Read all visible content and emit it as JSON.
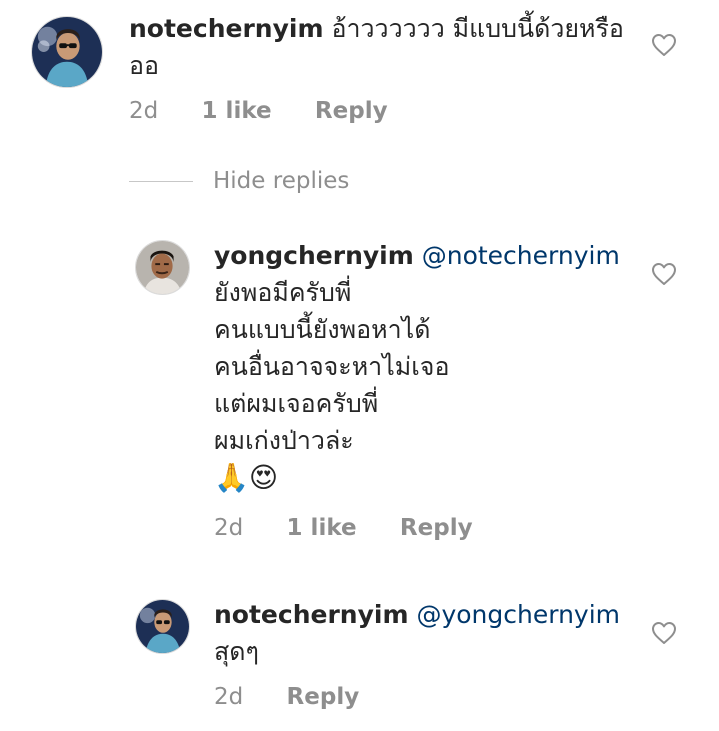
{
  "comments": [
    {
      "username": "notechernyim",
      "text_lines": [
        "อ้าวววววว มีแบบนี้ด้วยหรือ",
        "ออ"
      ],
      "time": "2d",
      "likes": "1 like",
      "reply": "Reply"
    },
    {
      "username": "yongchernyim",
      "mention": "@notechernyim",
      "text_lines": [
        "ยังพอมีครับพี่",
        "คนแบบนี้ยังพอหาได้",
        "คนอื่นอาจจะหาไม่เจอ",
        "แต่ผมเจอครับพี่",
        "ผมเก่งป่าวล่ะ"
      ],
      "emoji_line": "🙏😍",
      "time": "2d",
      "likes": "1 like",
      "reply": "Reply"
    },
    {
      "username": "notechernyim",
      "mention": "@yongchernyim",
      "text_lines": [
        "สุดๆ"
      ],
      "time": "2d",
      "reply": "Reply"
    }
  ],
  "hide_replies": "Hide replies",
  "icons": {
    "like": "heart-outline-icon"
  },
  "colors": {
    "mention": "#00376b",
    "meta": "#8e8e8e"
  }
}
